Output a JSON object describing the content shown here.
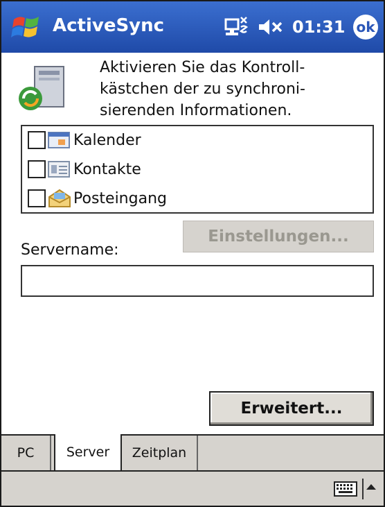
{
  "titlebar": {
    "app_title": "ActiveSync",
    "clock": "01:31",
    "ok_label": "ok",
    "icons": [
      "windows-start-icon",
      "connectivity-icon",
      "speaker-muted-icon"
    ]
  },
  "content": {
    "intro_text": "Aktivieren Sie das Kontroll-\nkästchen der zu synchroni-\nsierenden Informationen.",
    "sync_items": [
      {
        "label": "Kalender",
        "checked": false,
        "icon": "calendar-icon"
      },
      {
        "label": "Kontakte",
        "checked": false,
        "icon": "contacts-icon"
      },
      {
        "label": "Posteingang",
        "checked": false,
        "icon": "inbox-icon"
      }
    ],
    "settings_button": "Einstellungen...",
    "server_label": "Servername:",
    "server_value": "",
    "advanced_button": "Erweitert..."
  },
  "tabs": [
    {
      "label": "PC",
      "active": false
    },
    {
      "label": "Server",
      "active": true
    },
    {
      "label": "Zeitplan",
      "active": false
    }
  ],
  "menubar": {
    "icons": [
      "keyboard-icon",
      "arrow-up-icon"
    ]
  },
  "colors": {
    "titlebar_blue": "#2a56b8",
    "chrome_gray": "#d6d3ce",
    "disabled_text": "#9a9890"
  }
}
